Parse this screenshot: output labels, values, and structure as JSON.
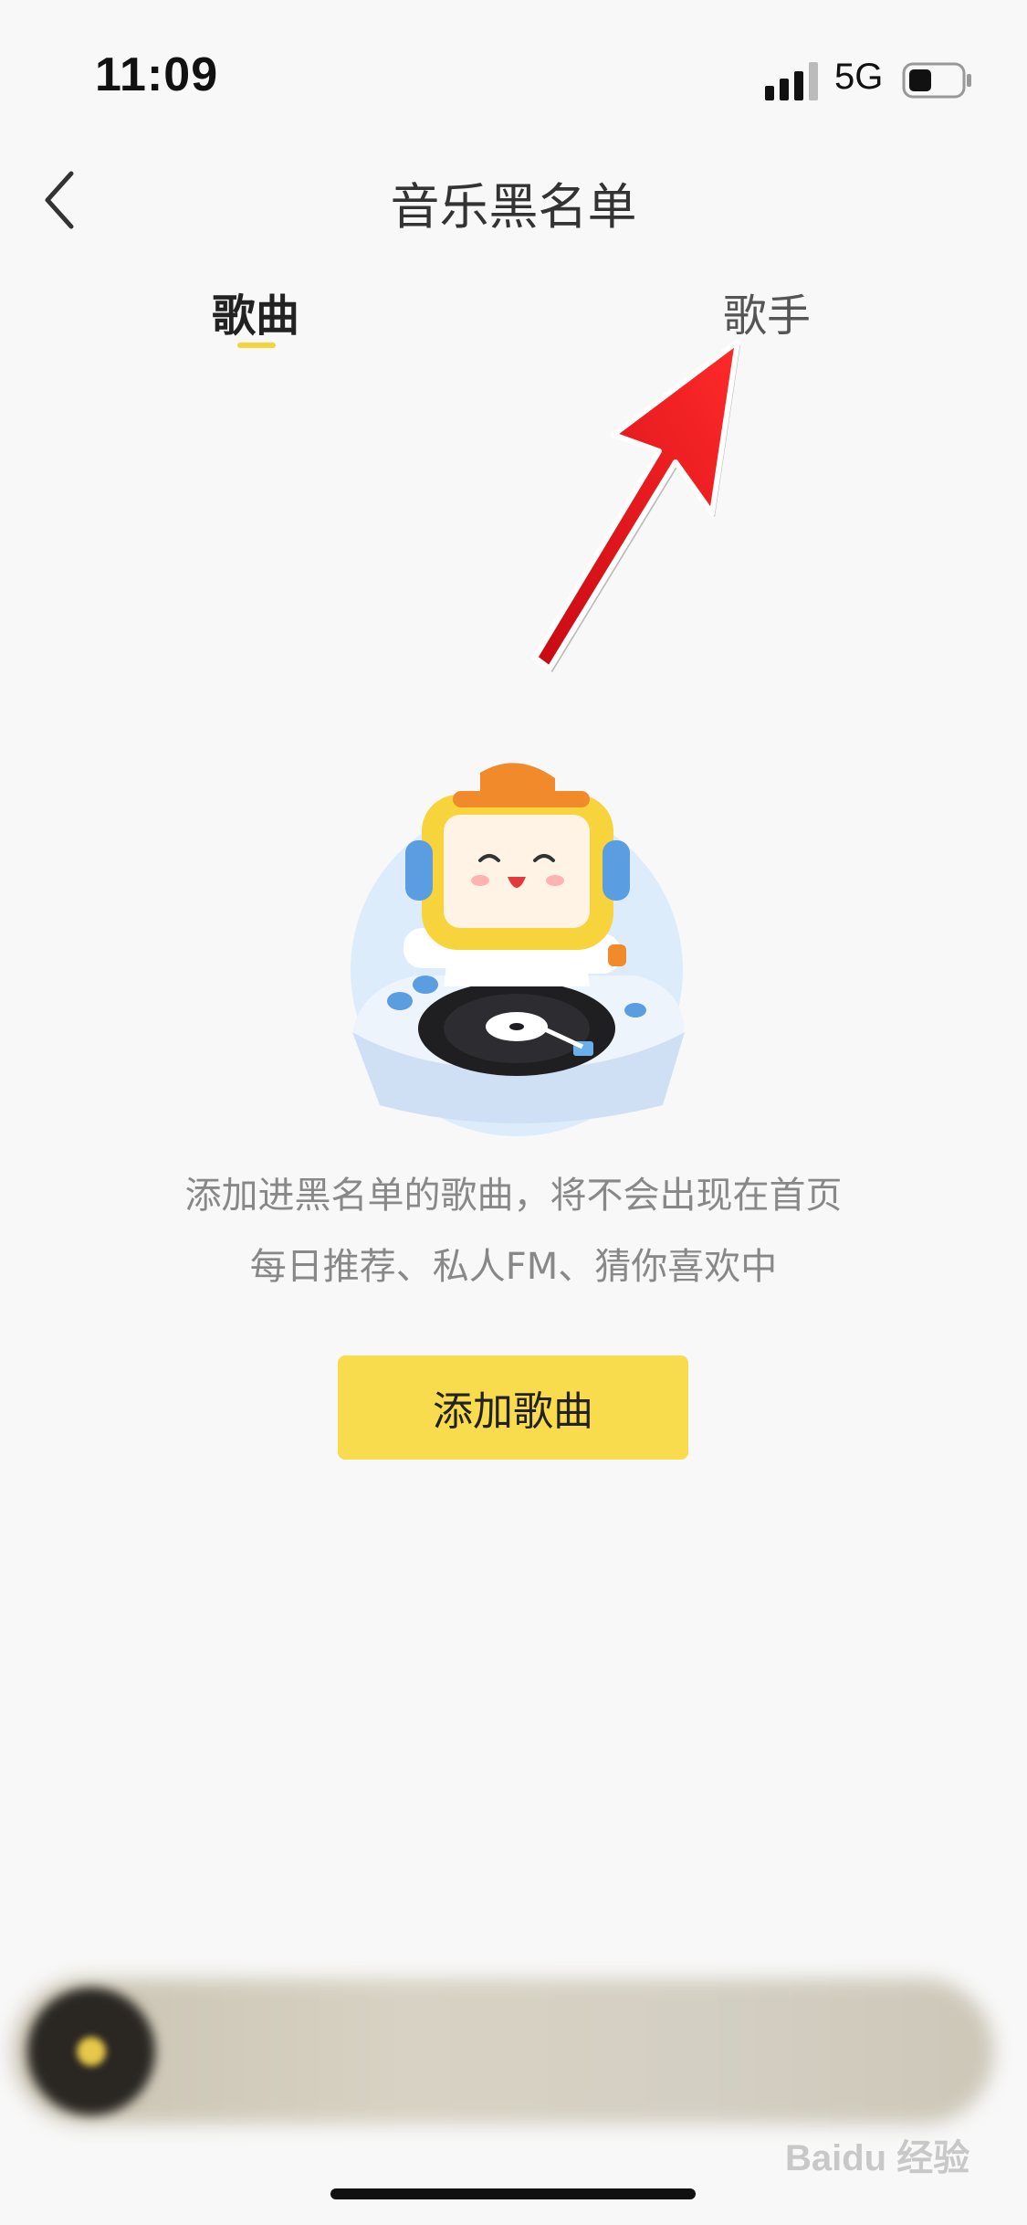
{
  "status_bar": {
    "time": "11:09",
    "network": "5G"
  },
  "nav": {
    "title": "音乐黑名单"
  },
  "tabs": [
    {
      "label": "歌曲",
      "active": true
    },
    {
      "label": "歌手",
      "active": false
    }
  ],
  "empty_state": {
    "line1": "添加进黑名单的歌曲，将不会出现在首页",
    "line2": "每日推荐、私人FM、猜你喜欢中"
  },
  "add_button_label": "添加歌曲",
  "watermark": "Baidu 经验",
  "colors": {
    "accent": "#f8dc4e",
    "arrow": "#e8141e"
  }
}
